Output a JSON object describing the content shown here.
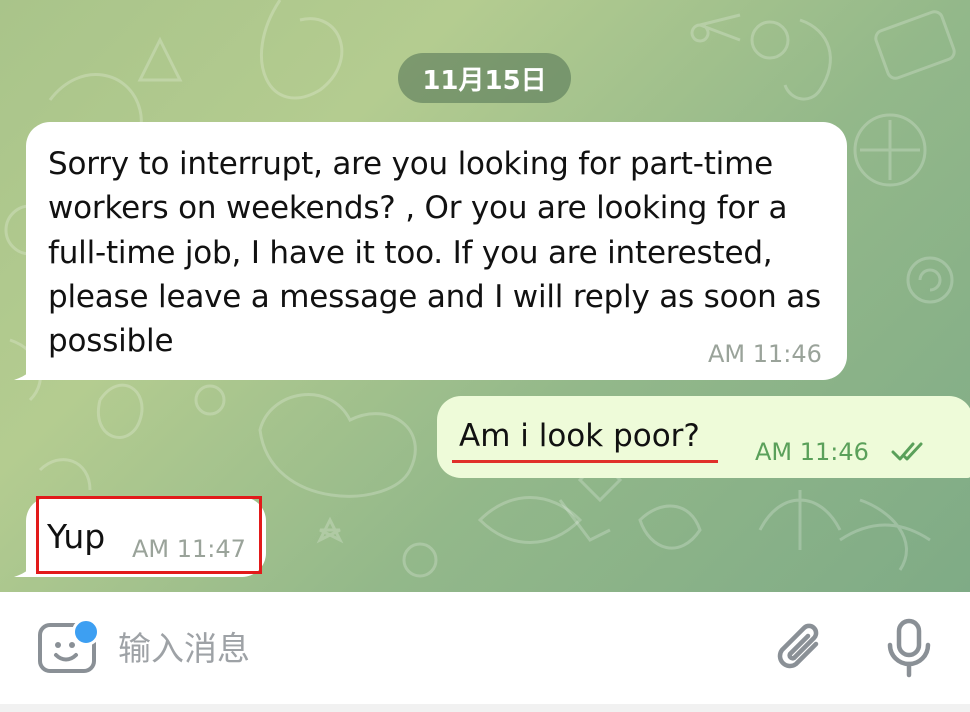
{
  "date_label": "11月15日",
  "messages": [
    {
      "direction": "incoming",
      "text": "Sorry to interrupt, are you looking for part-time workers on weekends? , Or you are looking for a full-time job, I have it too. If you are interested, please leave a message and I will reply as soon as possible",
      "time": "AM 11:46"
    },
    {
      "direction": "outgoing",
      "text": "Am i look poor?",
      "time": "AM 11:46",
      "status": "read"
    },
    {
      "direction": "incoming",
      "text": "Yup",
      "time": "AM 11:47"
    }
  ],
  "input": {
    "placeholder": "输入消息",
    "value": ""
  },
  "icons": {
    "emoji": "sticker-emoji-icon",
    "attach": "paperclip-icon",
    "mic": "microphone-icon",
    "read": "double-check-icon"
  },
  "colors": {
    "incoming_bubble": "#ffffff",
    "outgoing_bubble": "#eefbd9",
    "outgoing_time": "#5aa05a",
    "highlight": "#e21a1a",
    "badge": "#3d9ff2"
  }
}
